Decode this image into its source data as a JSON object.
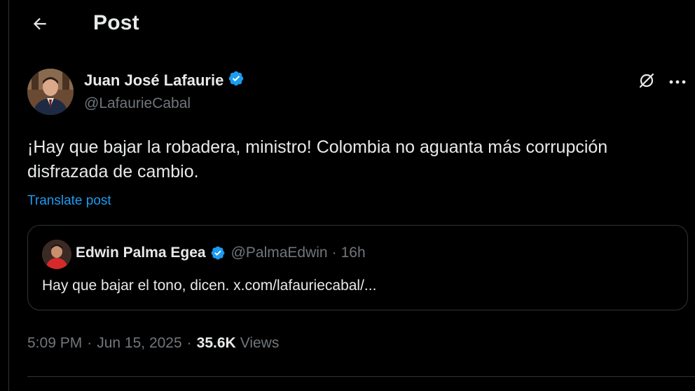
{
  "header": {
    "title": "Post",
    "back_icon": "arrow-left-icon"
  },
  "post": {
    "author": {
      "name": "Juan José Lafaurie",
      "handle": "@LafaurieCabal",
      "verified": true,
      "avatar_icon": "avatar-photo"
    },
    "text": "¡Hay que bajar la robadera, ministro! Colombia no aguanta más corrupción disfrazada de cambio.",
    "translate_label": "Translate post",
    "actions": {
      "grok_icon": "grok-icon",
      "more_icon": "more-horizontal-icon"
    },
    "quote": {
      "author_name": "Edwin Palma Egea",
      "handle": "@PalmaEdwin",
      "separator": "·",
      "time": "16h",
      "verified": true,
      "text": "Hay que bajar el tono, dicen. x.com/lafauriecabal/..."
    },
    "meta": {
      "time": "5:09 PM",
      "separator": "·",
      "date": "Jun 15, 2025",
      "views_count": "35.6K",
      "views_label": "Views"
    }
  },
  "colors": {
    "background": "#000000",
    "text": "#e7e9ea",
    "muted": "#71767b",
    "accent": "#1d9bf0",
    "border": "#2f3336"
  }
}
